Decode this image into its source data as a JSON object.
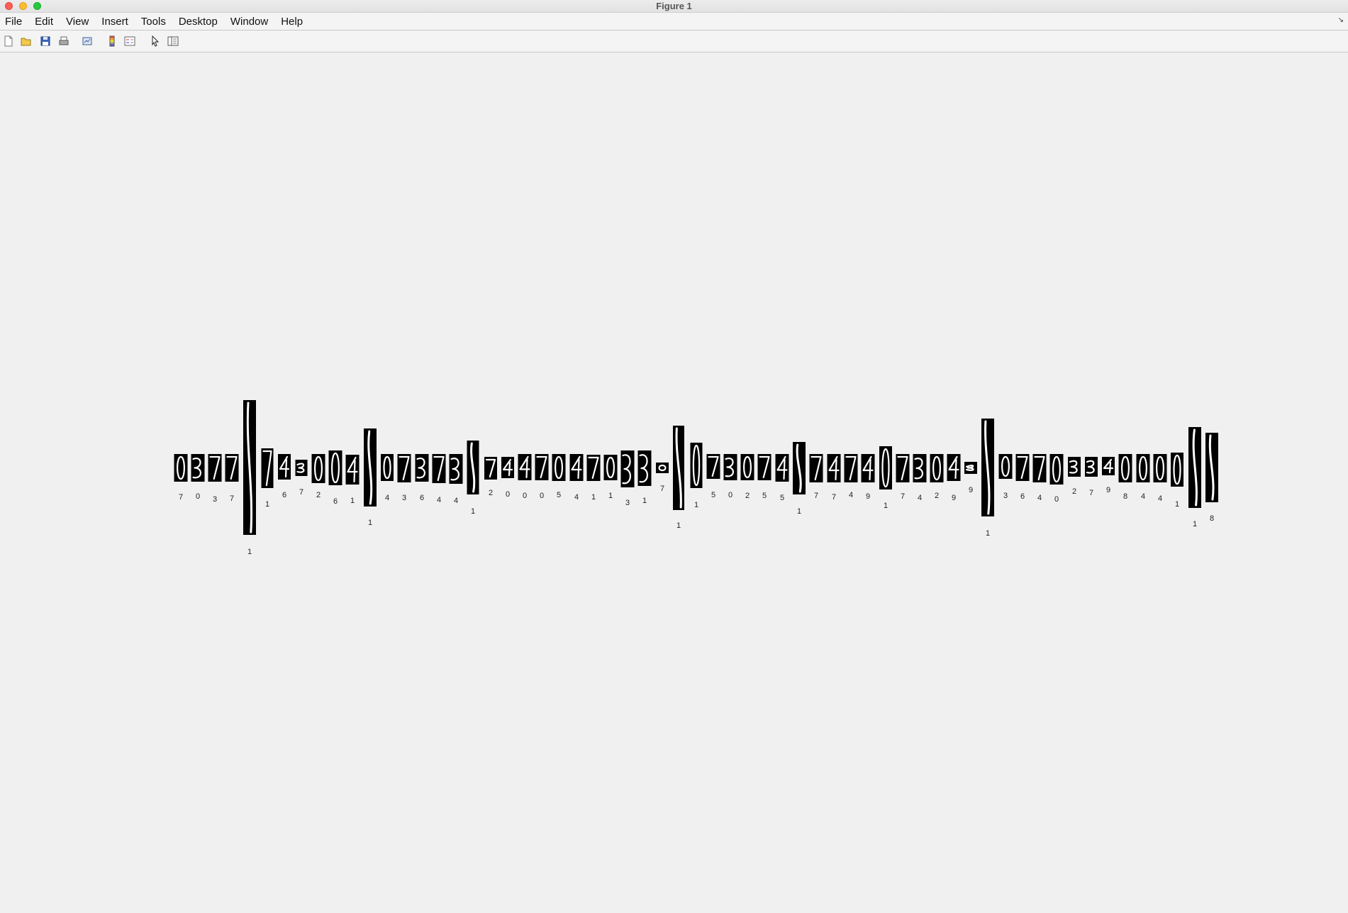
{
  "window": {
    "title": "Figure 1"
  },
  "menu": [
    "File",
    "Edit",
    "View",
    "Insert",
    "Tools",
    "Desktop",
    "Window",
    "Help"
  ],
  "menu_corner_glyph": "↘",
  "toolbar": {
    "icons": [
      "new-figure-icon",
      "open-file-icon",
      "save-icon",
      "print-icon",
      "link-plot-icon",
      "colorbar-icon",
      "legend-icon",
      "pointer-icon",
      "property-inspector-icon"
    ]
  },
  "figure": {
    "background": "#f0f0f0",
    "tile_color": "#000000",
    "stroke_color": "#ffffff",
    "labels": [
      "7",
      "0",
      "3",
      "7",
      "1",
      "1",
      "6",
      "7",
      "2",
      "6",
      "1",
      "1",
      "4",
      "3",
      "6",
      "4",
      "4",
      "1",
      "2",
      "0",
      "0",
      "0",
      "5",
      "4",
      "1",
      "1",
      "3",
      "1",
      "7",
      "1",
      "1",
      "5",
      "0",
      "2",
      "5",
      "5",
      "1",
      "7",
      "7",
      "4",
      "9",
      "1",
      "7",
      "4",
      "2",
      "9",
      "9",
      "1",
      "3",
      "6",
      "4",
      "0",
      "2",
      "7",
      "9",
      "8",
      "4",
      "4",
      "1",
      "1",
      "8"
    ]
  }
}
